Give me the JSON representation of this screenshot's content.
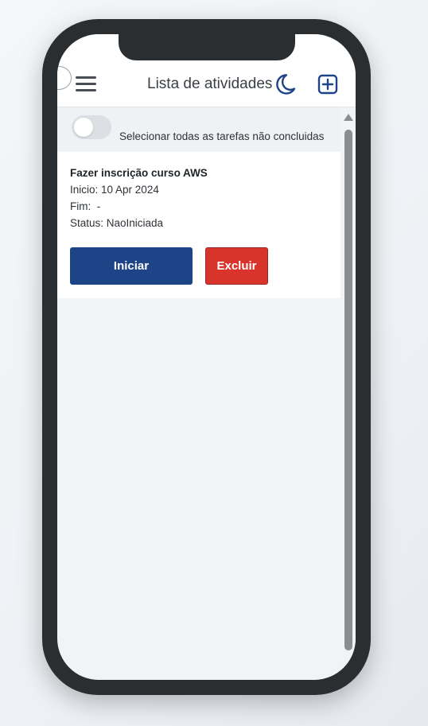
{
  "header": {
    "title": "Lista de atividades",
    "menu_icon": "hamburger-menu-icon",
    "theme_icon": "moon-icon",
    "add_icon": "plus-square-icon"
  },
  "select_all": {
    "label": "Selecionar todas as tarefas não concluidas",
    "checked": false
  },
  "tasks": [
    {
      "title": "Fazer inscrição curso AWS",
      "start": "Inicio: 10 Apr 2024",
      "end": "Fim:  -",
      "status": "Status: NaoIniciada",
      "start_button": "Iniciar",
      "delete_button": "Excluir"
    }
  ],
  "colors": {
    "primary": "#1e4488",
    "danger": "#d8342b",
    "phone_frame": "#2b2e31"
  }
}
